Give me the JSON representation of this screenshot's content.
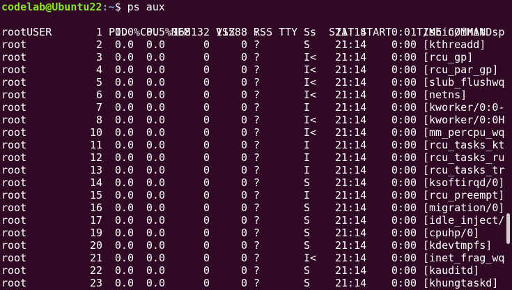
{
  "prompt": {
    "user_host": "codelab@Ubuntu22",
    "path": ":~",
    "symbol": "$",
    "command": " ps aux"
  },
  "header": [
    "USER",
    "PID",
    "%CPU",
    "%MEM",
    "VSZ",
    "RSS",
    "TTY",
    "STAT",
    "START",
    "TIME",
    "COMMAND"
  ],
  "processes": [
    [
      "root",
      "1",
      "0.0",
      "0.5",
      "168132",
      "11588",
      "?",
      "Ss",
      "21:14",
      "0:01",
      "/sbin/init sp"
    ],
    [
      "root",
      "2",
      "0.0",
      "0.0",
      "0",
      "0",
      "?",
      "S",
      "21:14",
      "0:00",
      "[kthreadd]"
    ],
    [
      "root",
      "3",
      "0.0",
      "0.0",
      "0",
      "0",
      "?",
      "I<",
      "21:14",
      "0:00",
      "[rcu_gp]"
    ],
    [
      "root",
      "4",
      "0.0",
      "0.0",
      "0",
      "0",
      "?",
      "I<",
      "21:14",
      "0:00",
      "[rcu_par_gp]"
    ],
    [
      "root",
      "5",
      "0.0",
      "0.0",
      "0",
      "0",
      "?",
      "I<",
      "21:14",
      "0:00",
      "[slub_flushwq"
    ],
    [
      "root",
      "6",
      "0.0",
      "0.0",
      "0",
      "0",
      "?",
      "I<",
      "21:14",
      "0:00",
      "[netns]"
    ],
    [
      "root",
      "7",
      "0.0",
      "0.0",
      "0",
      "0",
      "?",
      "I",
      "21:14",
      "0:00",
      "[kworker/0:0-"
    ],
    [
      "root",
      "8",
      "0.0",
      "0.0",
      "0",
      "0",
      "?",
      "I<",
      "21:14",
      "0:00",
      "[kworker/0:0H"
    ],
    [
      "root",
      "10",
      "0.0",
      "0.0",
      "0",
      "0",
      "?",
      "I<",
      "21:14",
      "0:00",
      "[mm_percpu_wq"
    ],
    [
      "root",
      "11",
      "0.0",
      "0.0",
      "0",
      "0",
      "?",
      "I",
      "21:14",
      "0:00",
      "[rcu_tasks_kt"
    ],
    [
      "root",
      "12",
      "0.0",
      "0.0",
      "0",
      "0",
      "?",
      "I",
      "21:14",
      "0:00",
      "[rcu_tasks_ru"
    ],
    [
      "root",
      "13",
      "0.0",
      "0.0",
      "0",
      "0",
      "?",
      "I",
      "21:14",
      "0:00",
      "[rcu_tasks_tr"
    ],
    [
      "root",
      "14",
      "0.0",
      "0.0",
      "0",
      "0",
      "?",
      "S",
      "21:14",
      "0:00",
      "[ksoftirqd/0]"
    ],
    [
      "root",
      "15",
      "0.0",
      "0.0",
      "0",
      "0",
      "?",
      "I",
      "21:14",
      "0:00",
      "[rcu_preempt]"
    ],
    [
      "root",
      "16",
      "0.0",
      "0.0",
      "0",
      "0",
      "?",
      "S",
      "21:14",
      "0:00",
      "[migration/0]"
    ],
    [
      "root",
      "17",
      "0.0",
      "0.0",
      "0",
      "0",
      "?",
      "S",
      "21:14",
      "0:00",
      "[idle_inject/"
    ],
    [
      "root",
      "19",
      "0.0",
      "0.0",
      "0",
      "0",
      "?",
      "S",
      "21:14",
      "0:00",
      "[cpuhp/0]"
    ],
    [
      "root",
      "20",
      "0.0",
      "0.0",
      "0",
      "0",
      "?",
      "S",
      "21:14",
      "0:00",
      "[kdevtmpfs]"
    ],
    [
      "root",
      "21",
      "0.0",
      "0.0",
      "0",
      "0",
      "?",
      "I<",
      "21:14",
      "0:00",
      "[inet_frag_wq"
    ],
    [
      "root",
      "22",
      "0.0",
      "0.0",
      "0",
      "0",
      "?",
      "S",
      "21:14",
      "0:00",
      "[kauditd]"
    ],
    [
      "root",
      "23",
      "0.0",
      "0.0",
      "0",
      "0",
      "?",
      "S",
      "21:14",
      "0:00",
      "[khungtaskd]"
    ]
  ],
  "colors": {
    "background": "#300a24",
    "user_host": "#8ae234",
    "path": "#729fcf",
    "text": "#ffffff"
  }
}
